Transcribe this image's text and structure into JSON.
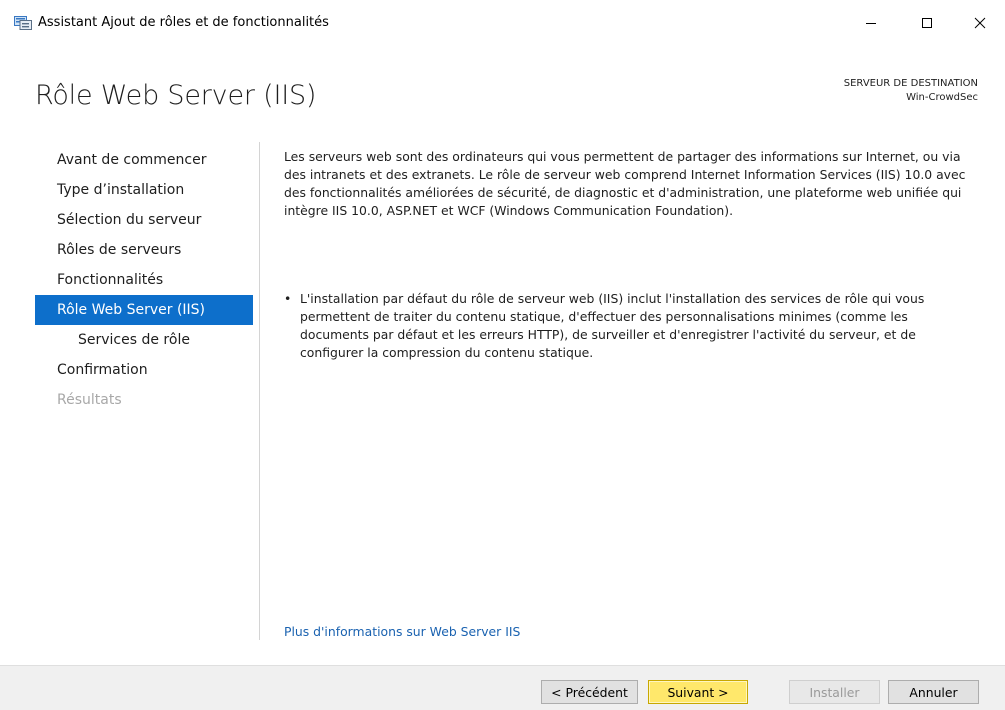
{
  "window": {
    "title": "Assistant Ajout de rôles et de fonctionnalités"
  },
  "header": {
    "page_title": "Rôle Web Server (IIS)",
    "dest_label": "SERVEUR DE DESTINATION",
    "dest_server": "Win-CrowdSec"
  },
  "sidebar": {
    "items": [
      {
        "label": "Avant de commencer"
      },
      {
        "label": "Type d’installation"
      },
      {
        "label": "Sélection du serveur"
      },
      {
        "label": "Rôles de serveurs"
      },
      {
        "label": "Fonctionnalités"
      },
      {
        "label": "Rôle Web Server (IIS)"
      },
      {
        "label": "Services de rôle"
      },
      {
        "label": "Confirmation"
      },
      {
        "label": "Résultats"
      }
    ]
  },
  "main": {
    "intro": "Les serveurs web sont des ordinateurs qui vous permettent de partager des informations sur Internet, ou via des intranets et des extranets. Le rôle de serveur web comprend Internet Information Services (IIS) 10.0 avec des fonctionnalités améliorées de sécurité, de diagnostic et d'administration, une plateforme web unifiée qui intègre IIS 10.0, ASP.NET et WCF (Windows Communication Foundation).",
    "bullets": [
      {
        "text": "L'installation par défaut du rôle de serveur web (IIS) inclut l'installation des services de rôle qui vous permettent de traiter du contenu statique, d'effectuer des personnalisations minimes (comme les documents par défaut et les erreurs HTTP), de surveiller et d'enregistrer l'activité du serveur, et de configurer la compression du contenu statique."
      }
    ],
    "more_link": "Plus d'informations sur Web Server IIS"
  },
  "footer": {
    "prev_label": "< Précédent",
    "next_label": "Suivant >",
    "install_label": "Installer",
    "cancel_label": "Annuler"
  },
  "colors": {
    "accent": "#0d6fcb",
    "link": "#1a62b0",
    "next_highlight": "#ffe86b"
  },
  "icons": {
    "app": "server-manager-icon",
    "minimize": "minimize-icon",
    "maximize": "maximize-icon",
    "close": "close-icon"
  }
}
